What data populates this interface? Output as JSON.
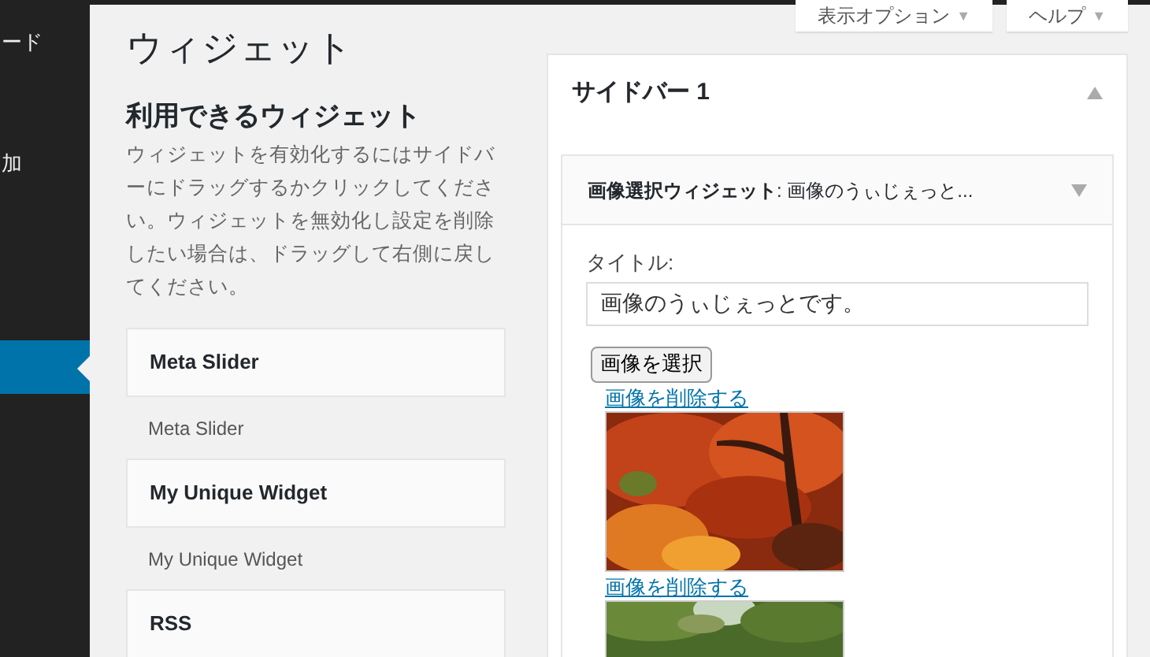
{
  "admin_menu": [
    {
      "label": "ード",
      "selected": false
    },
    {
      "label": "加",
      "selected": false
    },
    {
      "selected": true
    }
  ],
  "screen_options": [
    {
      "label": "表示オプション",
      "caret": "▼"
    },
    {
      "label": "ヘルプ",
      "caret": "▼"
    }
  ],
  "page_title": "ウィジェット",
  "available_widgets": {
    "title": "利用できるウィジェット",
    "description": "ウィジェットを有効化するにはサイドバーにドラッグするかクリックしてください。ウィジェットを無効化し設定を削除したい場合は、ドラッグして右側に戻してください。",
    "widgets": [
      {
        "name": "Meta Slider",
        "description": "Meta Slider"
      },
      {
        "name": "My Unique Widget",
        "description": "My Unique Widget"
      },
      {
        "name": "RSS"
      }
    ]
  },
  "sidebar_area": {
    "title": "サイドバー 1",
    "expanded": true,
    "widget": {
      "title": "画像選択ウィジェット",
      "subtitle": ": 画像のうぃじぇっと...",
      "expanded": true,
      "title_label": "タイトル:",
      "title_value": "画像のうぃじぇっとです。",
      "select_button": "画像を選択",
      "images": [
        {
          "remove_link": "画像を削除する",
          "kind": "autumn"
        },
        {
          "remove_link": "画像を削除する",
          "kind": "forest"
        }
      ]
    }
  }
}
